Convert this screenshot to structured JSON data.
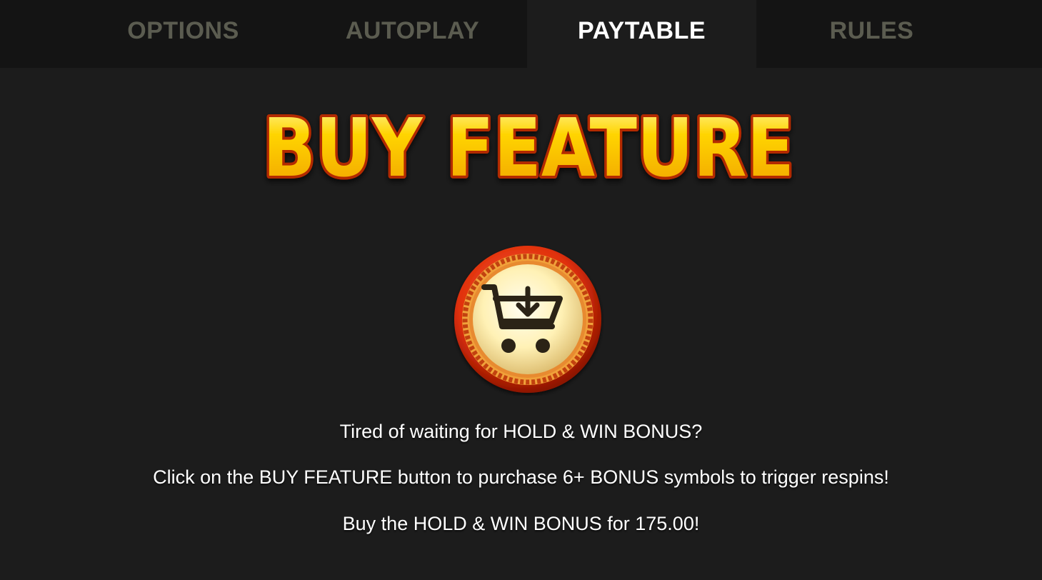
{
  "tabs": [
    {
      "label": "OPTIONS",
      "active": false
    },
    {
      "label": "AUTOPLAY",
      "active": false
    },
    {
      "label": "PAYTABLE",
      "active": true
    },
    {
      "label": "RULES",
      "active": false
    }
  ],
  "feature": {
    "title": "BUY FEATURE",
    "icon": "shopping-cart-download-icon",
    "lines": [
      "Tired of waiting for HOLD & WIN BONUS?",
      "Click on the BUY FEATURE button to purchase 6+ BONUS symbols to trigger respins!",
      "Buy the HOLD & WIN BONUS for 175.00!"
    ]
  },
  "colors": {
    "background": "#1c1c1c",
    "tabbar": "#141414",
    "tab_inactive": "#5b5c50",
    "tab_active": "#ffffff",
    "title_gold": "#ffd200",
    "title_outline": "#b32a00",
    "coin_rim": "#d8240c",
    "coin_face": "#fff3c2"
  }
}
